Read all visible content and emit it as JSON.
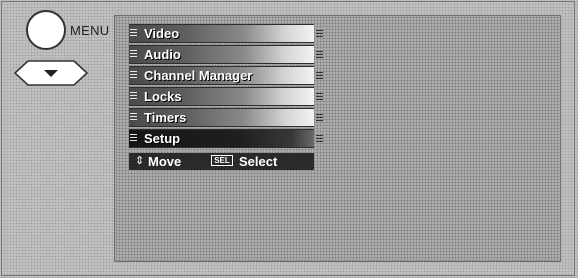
{
  "remote": {
    "menu_button_label": "MENU",
    "menu_button_icon": "circle-button-icon",
    "down_button_icon": "down-arrow-button-icon"
  },
  "menu": {
    "items": [
      {
        "label": "Video",
        "selected": false
      },
      {
        "label": "Audio",
        "selected": false
      },
      {
        "label": "Channel Manager",
        "selected": false
      },
      {
        "label": "Locks",
        "selected": false
      },
      {
        "label": "Timers",
        "selected": false
      },
      {
        "label": "Setup",
        "selected": true
      }
    ]
  },
  "hint": {
    "move_icon": "four-way-arrow-icon",
    "move_label": "Move",
    "select_key": "SEL",
    "select_label": "Select"
  },
  "colors": {
    "selected_item": "#1a1a1a",
    "panel_bg": "#ababab",
    "item_text": "#ffffff"
  }
}
